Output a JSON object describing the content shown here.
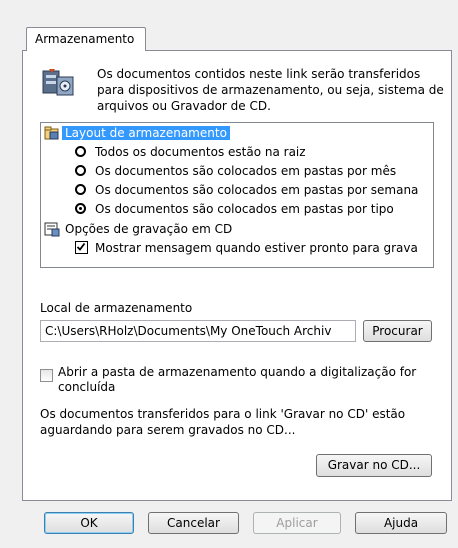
{
  "tab": {
    "label": "Armazenamento"
  },
  "description": "Os documentos contidos neste link serão transferidos para dispositivos de armazenamento, ou seja, sistema de arquivos ou Gravador de CD.",
  "tree": {
    "layout_header": "Layout de armazenamento",
    "options": [
      {
        "label": "Todos os documentos estão na raiz",
        "selected": false
      },
      {
        "label": "Os documentos são colocados em pastas por mês",
        "selected": false
      },
      {
        "label": "Os documentos são colocados em pastas por semana",
        "selected": false
      },
      {
        "label": "Os documentos são colocados em pastas por tipo",
        "selected": true
      }
    ],
    "cd_header": "Opções de gravação em CD",
    "cd_option": {
      "label": "Mostrar mensagem quando estiver pronto para grava",
      "checked": true
    }
  },
  "storage": {
    "label": "Local de armazenamento",
    "path": "C:\\Users\\RHolz\\Documents\\My OneTouch Archiv",
    "browse_label": "Procurar"
  },
  "open_folder": {
    "label": "Abrir a pasta de armazenamento quando a digitalização for concluída",
    "checked": false
  },
  "cd_info": "Os documentos transferidos para o link 'Gravar no CD' estão aguardando para serem gravados no CD...",
  "burn_button": "Gravar no CD...",
  "footer": {
    "ok": "OK",
    "cancel": "Cancelar",
    "apply": "Aplicar",
    "help": "Ajuda"
  },
  "colors": {
    "selection": "#3399ff",
    "window_bg": "#f0f0f0"
  }
}
